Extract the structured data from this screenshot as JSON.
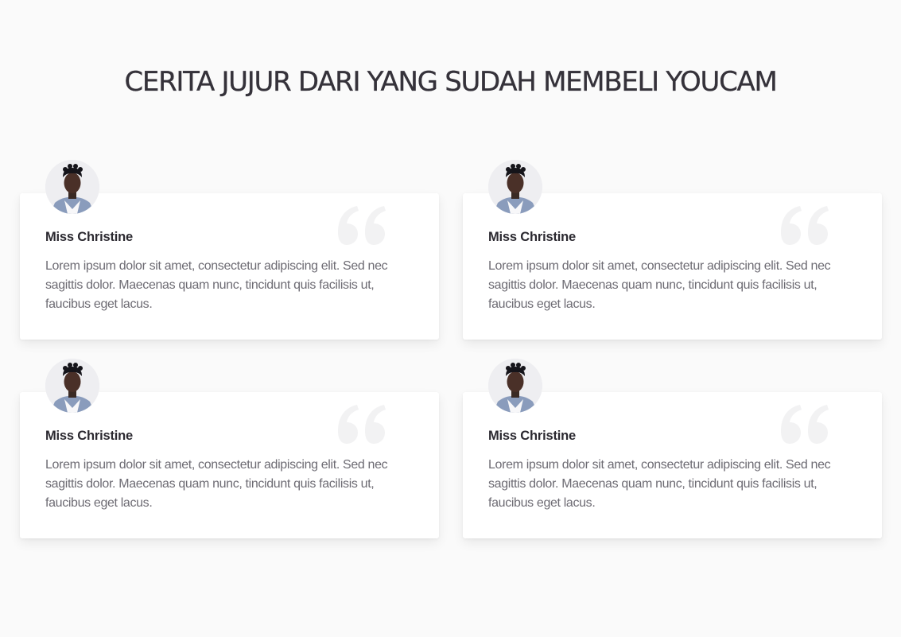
{
  "section": {
    "title": "CERITA JUJUR DARI YANG SUDAH MEMBELI YOUCAM"
  },
  "testimonials": [
    {
      "name": "Miss Christine",
      "text": "Lorem ipsum dolor sit amet, consectetur adipiscing elit. Sed nec sagittis dolor. Maecenas quam nunc, tincidunt quis facilisis ut, faucibus eget lacus.",
      "avatar": "person-avatar",
      "quote_icon": "quote-icon"
    },
    {
      "name": "Miss Christine",
      "text": "Lorem ipsum dolor sit amet, consectetur adipiscing elit. Sed nec sagittis dolor. Maecenas quam nunc, tincidunt quis facilisis ut, faucibus eget lacus.",
      "avatar": "person-avatar",
      "quote_icon": "quote-icon"
    },
    {
      "name": "Miss Christine",
      "text": "Lorem ipsum dolor sit amet, consectetur adipiscing elit. Sed nec sagittis dolor. Maecenas quam nunc, tincidunt quis facilisis ut, faucibus eget lacus.",
      "avatar": "person-avatar",
      "quote_icon": "quote-icon"
    },
    {
      "name": "Miss Christine",
      "text": "Lorem ipsum dolor sit amet, consectetur adipiscing elit. Sed nec sagittis dolor. Maecenas quam nunc, tincidunt quis facilisis ut, faucibus eget lacus.",
      "avatar": "person-avatar",
      "quote_icon": "quote-icon"
    }
  ],
  "colors": {
    "background": "#fafafa",
    "card": "#ffffff",
    "title": "#35323a",
    "name": "#2b2930",
    "body_text": "#6d6b73",
    "quote_mark": "#f2f2f3"
  }
}
